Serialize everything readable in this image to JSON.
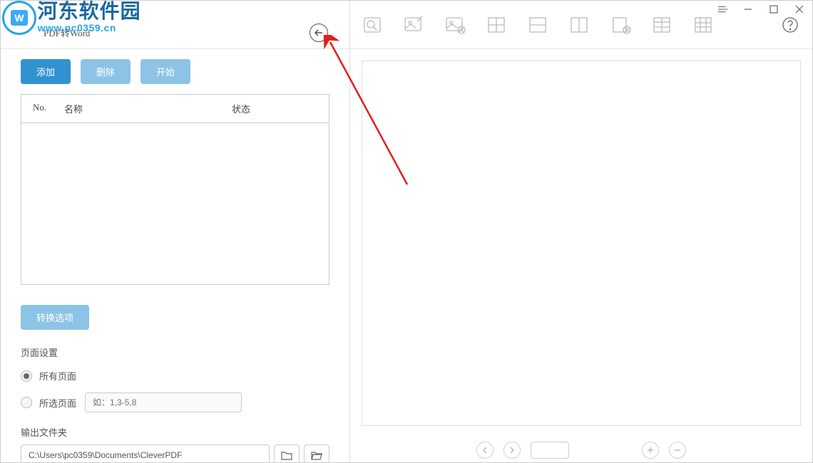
{
  "watermark": {
    "brand": "河东软件园",
    "url": "www.pc0359.cn",
    "logo_letter": "W"
  },
  "header": {
    "title": "PDF转Word"
  },
  "buttons": {
    "add": "添加",
    "delete": "删除",
    "start": "开始",
    "options": "转换选项"
  },
  "table": {
    "col_no": "No.",
    "col_name": "名称",
    "col_status": "状态"
  },
  "page_settings": {
    "label": "页面设置",
    "all_pages": "所有页面",
    "selected_pages": "所选页面",
    "range_placeholder": "如：1,3-5,8",
    "selected_value": "all"
  },
  "output": {
    "label": "输出文件夹",
    "path": "C:\\Users\\pc0359\\Documents\\CleverPDF"
  },
  "pager": {
    "total": ""
  }
}
